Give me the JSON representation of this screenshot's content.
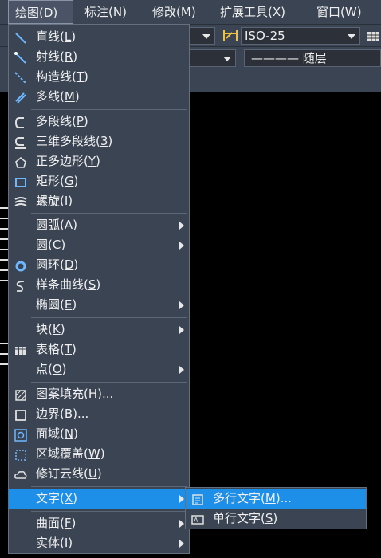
{
  "menubar": {
    "items": [
      {
        "label": "绘图(",
        "key": "D",
        "tail": ")"
      },
      {
        "label": "标注(",
        "key": "N",
        "tail": ")"
      },
      {
        "label": "修改(",
        "key": "M",
        "tail": ")"
      },
      {
        "label": "扩展工具(",
        "key": "X",
        "tail": ")"
      },
      {
        "label": "窗口(",
        "key": "W",
        "tail": ")"
      }
    ]
  },
  "toolbar": {
    "dimstyle": "ISO-25",
    "linetype": "———— 随层"
  },
  "draw_menu": {
    "items": [
      {
        "pre": "直线(",
        "key": "L",
        "post": ")",
        "icon": "line-icon"
      },
      {
        "pre": "射线(",
        "key": "R",
        "post": ")",
        "icon": "ray-icon"
      },
      {
        "pre": "构造线(",
        "key": "T",
        "post": ")",
        "icon": "construction-line-icon"
      },
      {
        "pre": "多线(",
        "key": "M",
        "post": ")",
        "icon": "multiline-icon"
      },
      {
        "pre": "多段线(",
        "key": "P",
        "post": ")",
        "icon": "polyline-icon"
      },
      {
        "pre": "三维多段线(",
        "key": "3",
        "post": ")",
        "icon": "3d-polyline-icon"
      },
      {
        "pre": "正多边形(",
        "key": "Y",
        "post": ")",
        "icon": "polygon-icon"
      },
      {
        "pre": "矩形(",
        "key": "G",
        "post": ")",
        "icon": "rectangle-icon"
      },
      {
        "pre": "螺旋(",
        "key": "I",
        "post": ")",
        "icon": "helix-icon"
      },
      {
        "pre": "圆弧(",
        "key": "A",
        "post": ")",
        "icon": ""
      },
      {
        "pre": "圆(",
        "key": "C",
        "post": ")",
        "icon": ""
      },
      {
        "pre": "圆环(",
        "key": "D",
        "post": ")",
        "icon": "donut-icon"
      },
      {
        "pre": "样条曲线(",
        "key": "S",
        "post": ")",
        "icon": "spline-icon"
      },
      {
        "pre": "椭圆(",
        "key": "E",
        "post": ")",
        "icon": ""
      },
      {
        "pre": "块(",
        "key": "K",
        "post": ")",
        "icon": ""
      },
      {
        "pre": "表格(",
        "key": "T",
        "post": ")",
        "icon": "table-icon"
      },
      {
        "pre": "点(",
        "key": "O",
        "post": ")",
        "icon": ""
      },
      {
        "pre": "图案填充(",
        "key": "H",
        "post": ")...",
        "icon": "hatch-icon"
      },
      {
        "pre": "边界(",
        "key": "B",
        "post": ")...",
        "icon": "boundary-icon"
      },
      {
        "pre": "面域(",
        "key": "N",
        "post": ")",
        "icon": "region-icon"
      },
      {
        "pre": "区域覆盖(",
        "key": "W",
        "post": ")",
        "icon": "wipeout-icon"
      },
      {
        "pre": "修订云线(",
        "key": "U",
        "post": ")",
        "icon": "revcloud-icon"
      },
      {
        "pre": "文字(",
        "key": "X",
        "post": ")",
        "icon": ""
      },
      {
        "pre": "曲面(",
        "key": "F",
        "post": ")",
        "icon": ""
      },
      {
        "pre": "实体(",
        "key": "I",
        "post": ")",
        "icon": ""
      }
    ]
  },
  "text_submenu": {
    "items": [
      {
        "pre": "多行文字(",
        "key": "M",
        "post": ")...",
        "icon": "mtext-icon"
      },
      {
        "pre": "单行文字(",
        "key": "S",
        "post": ")",
        "icon": "single-line-text-icon"
      }
    ]
  },
  "colors": {
    "accent": "#1e8fe8",
    "menu_bg": "#3b4453",
    "canvas": "#000000"
  }
}
